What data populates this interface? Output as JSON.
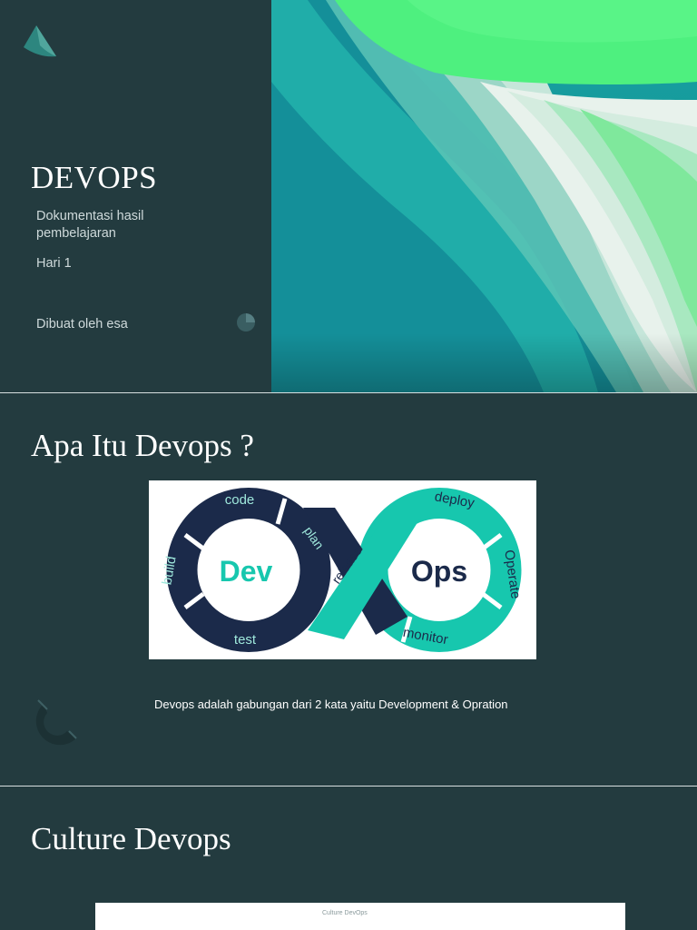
{
  "slide1": {
    "title": "DEVOPS",
    "subtitle": "Dokumentasi hasil pembelajaran",
    "day": "Hari 1",
    "author": "Dibuat oleh esa"
  },
  "slide2": {
    "heading": "Apa Itu Devops ?",
    "diagram": {
      "dev": "Dev",
      "ops": "Ops",
      "stages": [
        "code",
        "build",
        "test",
        "plan",
        "release",
        "deploy",
        "Operate",
        "monitor"
      ]
    },
    "description": "Devops adalah gabungan dari  2 kata yaitu Development & Opration"
  },
  "slide3": {
    "heading": "Culture Devops",
    "box_caption": "Culture DevOps"
  },
  "colors": {
    "background": "#233b3f",
    "navy": "#1b2a4a",
    "teal": "#17c7ae",
    "green": "#4ef07f"
  }
}
